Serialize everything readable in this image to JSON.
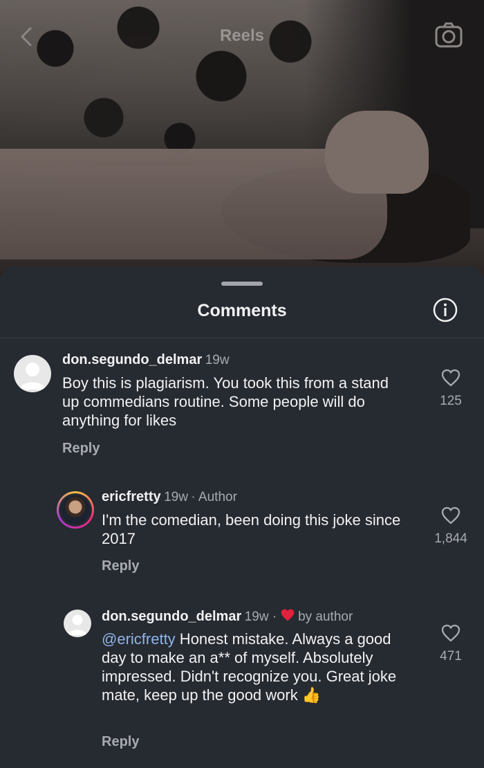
{
  "header": {
    "title": "Reels",
    "back_icon": "chevron-left-icon",
    "camera_icon": "camera-icon"
  },
  "sheet": {
    "title": "Comments",
    "info_icon": "info-icon"
  },
  "comments": [
    {
      "username": "don.segundo_delmar",
      "time": "19w",
      "text": "Boy this is plagiarism. You took this from a stand up commedians routine. Some people will do anything for likes",
      "reply_label": "Reply",
      "likes": "125"
    },
    {
      "username": "ericfretty",
      "time": "19w",
      "badge": "· Author",
      "text": "I'm the comedian, been doing this joke since 2017",
      "reply_label": "Reply",
      "likes": "1,844"
    },
    {
      "username": "don.segundo_delmar",
      "time": "19w ·",
      "liked_by": "by author",
      "mention": "@ericfretty",
      "text": " Honest mistake. Always a good day to make an a** of myself. Absolutely impressed. Didn't recognize you. Great joke mate, keep up the good work ",
      "emoji": "👍",
      "reply_label": "Reply",
      "likes": "471"
    }
  ],
  "colors": {
    "sheet_bg": "#262a31",
    "mention": "#8fb6e8",
    "heart": "#e0213a"
  }
}
